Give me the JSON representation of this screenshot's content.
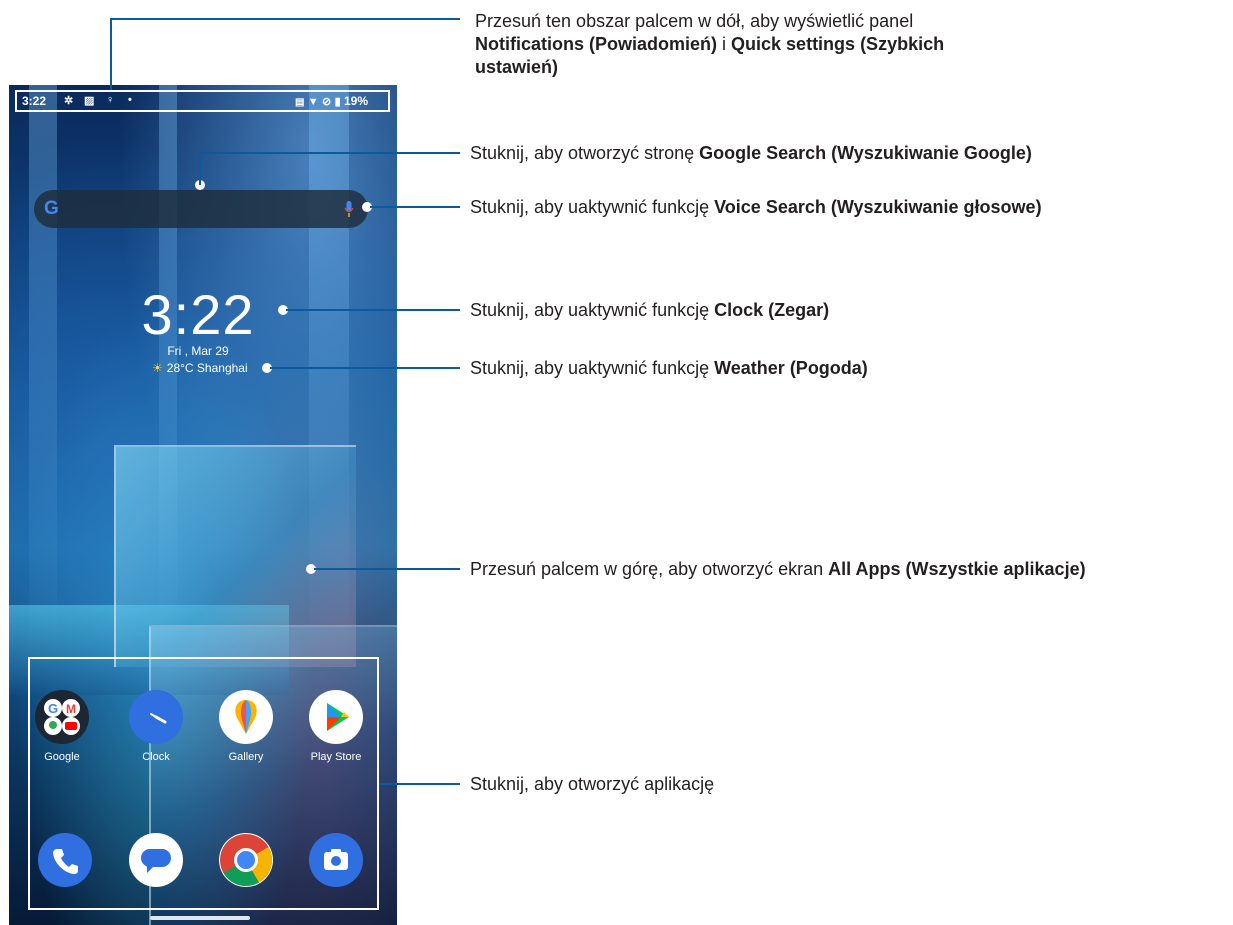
{
  "status_bar": {
    "time": "3:22",
    "battery": "19%",
    "icons": [
      "settings-gear-icon",
      "image-icon",
      "bulb-icon",
      "dot-icon",
      "nfc-icon",
      "wifi-icon",
      "no-sim-icon",
      "battery-icon"
    ]
  },
  "search_bar": {
    "logo": "G",
    "icons": [
      "google-logo-icon",
      "mic-icon"
    ]
  },
  "clock_widget": {
    "time": "3:22",
    "date": "Fri , Mar 29"
  },
  "weather_widget": {
    "icon": "sun-icon",
    "text": "28°C Shanghai"
  },
  "apps": {
    "row1": [
      {
        "label": "Google",
        "icon": "google-folder-icon"
      },
      {
        "label": "Clock",
        "icon": "clock-icon"
      },
      {
        "label": "Gallery",
        "icon": "gallery-icon"
      },
      {
        "label": "Play Store",
        "icon": "play-store-icon"
      }
    ],
    "dock": [
      {
        "icon": "phone-icon"
      },
      {
        "icon": "messages-icon"
      },
      {
        "icon": "chrome-icon"
      },
      {
        "icon": "camera-icon"
      }
    ]
  },
  "annotations": {
    "notifications": {
      "line1": "Przesuń ten obszar palcem w dół, aby wyświetlić panel",
      "bold1": "Notifications (Powiadomień)",
      "mid": " i ",
      "bold2": "Quick settings (Szybkich",
      "bold3": "ustawień)"
    },
    "google_search": {
      "text": "Stuknij, aby otworzyć stronę ",
      "bold": "Google Search (Wyszukiwanie Google)"
    },
    "voice_search": {
      "text": "Stuknij, aby uaktywnić funkcję ",
      "bold": "Voice Search (Wyszukiwanie głosowe)"
    },
    "clock": {
      "text": "Stuknij, aby uaktywnić funkcję ",
      "bold": "Clock (Zegar)"
    },
    "weather": {
      "text": "Stuknij, aby uaktywnić funkcję ",
      "bold": "Weather (Pogoda)"
    },
    "all_apps": {
      "text": "Przesuń palcem w górę, aby otworzyć ekran ",
      "bold": "All Apps (Wszystkie aplikacje)"
    },
    "open_app": {
      "text": "Stuknij, aby otworzyć aplikację"
    }
  },
  "colors": {
    "callout_line": "#0a5a9c",
    "text": "#231f20"
  }
}
